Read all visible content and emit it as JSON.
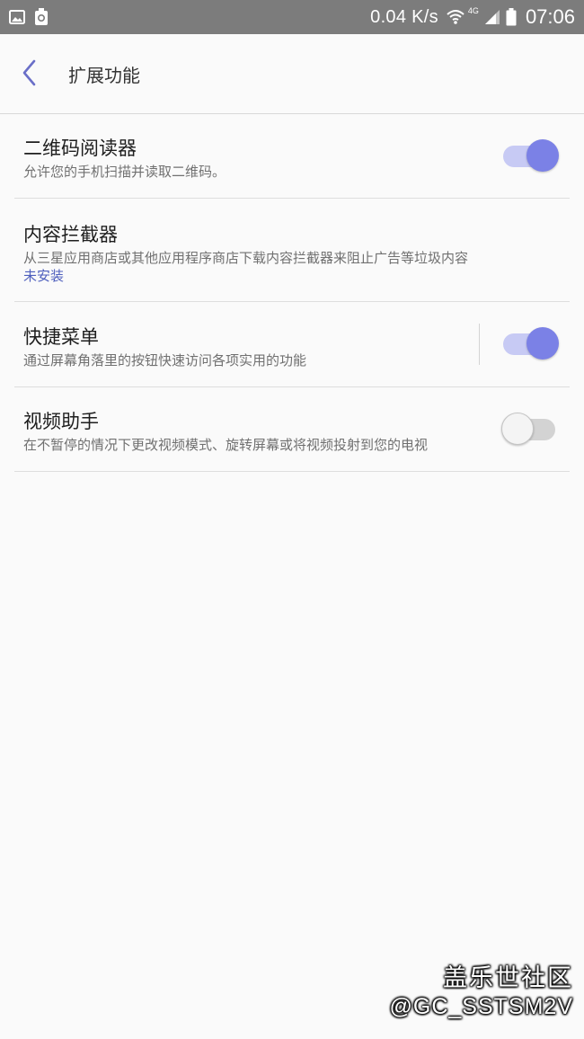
{
  "status_bar": {
    "net_speed": "0.04 K/s",
    "network_type": "4G",
    "time": "07:06",
    "left_icons": [
      "image-icon",
      "recycle-icon"
    ],
    "right_icons": [
      "wifi-icon",
      "signal-icon",
      "battery-icon"
    ]
  },
  "app_bar": {
    "back_icon": "back-arrow-icon",
    "title": "扩展功能"
  },
  "settings": [
    {
      "title": "二维码阅读器",
      "subtitle": "允许您的手机扫描并读取二维码。",
      "toggle": true
    },
    {
      "title": "内容拦截器",
      "subtitle": "从三星应用商店或其他应用程序商店下载内容拦截器来阻止广告等垃圾内容",
      "status": "未安装"
    },
    {
      "title": "快捷菜单",
      "subtitle": "通过屏幕角落里的按钮快速访问各项实用的功能",
      "toggle": true
    },
    {
      "title": "视频助手",
      "subtitle": "在不暂停的情况下更改视频模式、旋转屏幕或将视频投射到您的电视",
      "toggle": false
    }
  ],
  "watermark": {
    "line1": "盖乐世社区",
    "line2": "@GC_SSTSM2V"
  },
  "colors": {
    "accent": "#7b81e6",
    "accent_track": "#c7caf4",
    "status_bar": "#7c7c7c",
    "link": "#4e5fbd",
    "background": "#fafafa"
  }
}
